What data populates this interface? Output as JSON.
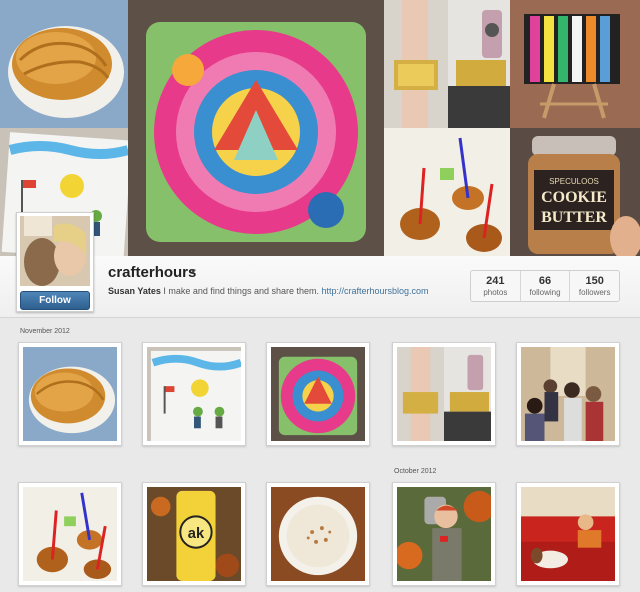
{
  "profile": {
    "username": "crafterhours",
    "full_name": "Susan Yates",
    "bio_text": "I make and find things and share them.",
    "website": "http://crafterhoursblog.com",
    "follow_label": "Follow",
    "caret": "▾"
  },
  "stats": [
    {
      "count": "241",
      "label": "photos"
    },
    {
      "count": "66",
      "label": "following"
    },
    {
      "count": "150",
      "label": "followers"
    }
  ],
  "months": {
    "first": "November 2012",
    "second": "October 2012"
  },
  "cover_tiles": [
    "croissant-photo",
    "drawing-photo",
    "quilted-pillow-photo",
    "glitter-cuff-photo",
    "cuff-camera-photo",
    "striped-canvas-photo",
    "caramel-apples-photo",
    "cookie-butter-jar-photo"
  ],
  "jar_label": {
    "top": "SPECULOOS",
    "line1": "COOKIE",
    "line2": "BUTTER"
  },
  "cup_label": "ak",
  "grid": [
    {
      "name": "croissant-photo"
    },
    {
      "name": "drawing-photo"
    },
    {
      "name": "quilted-pillow-photo"
    },
    {
      "name": "glitter-cuff-photo"
    },
    {
      "name": "hallway-crowd-photo"
    },
    {
      "name": "caramel-apples-photo"
    },
    {
      "name": "yellow-cup-photo"
    },
    {
      "name": "latte-photo"
    },
    {
      "name": "child-costume-photo"
    },
    {
      "name": "red-couch-photo"
    }
  ]
}
